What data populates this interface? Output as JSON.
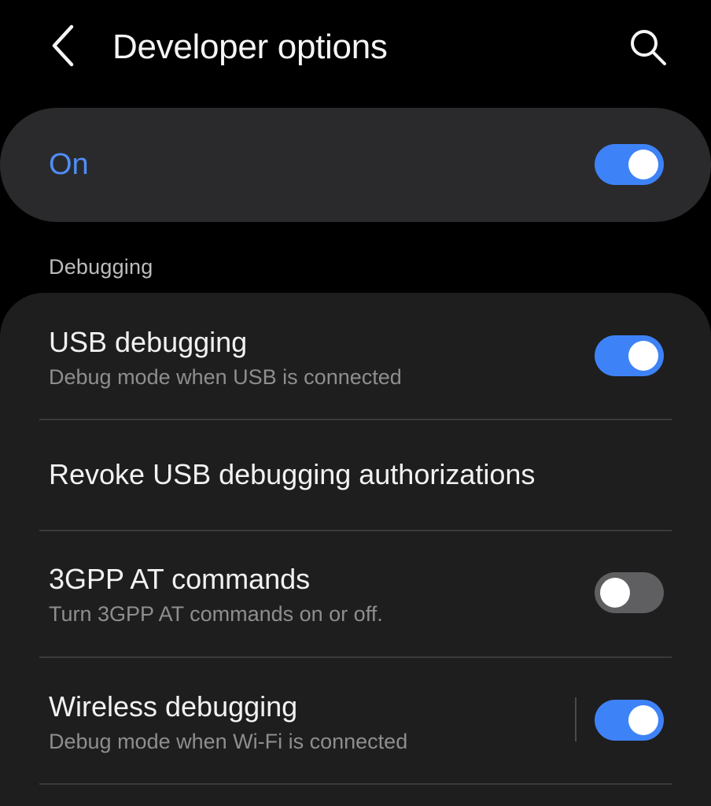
{
  "header": {
    "title": "Developer options",
    "back_icon": "chevron-left-icon",
    "search_icon": "search-icon"
  },
  "master": {
    "label": "On",
    "enabled": true
  },
  "section": {
    "title": "Debugging"
  },
  "items": [
    {
      "title": "USB debugging",
      "subtitle": "Debug mode when USB is connected",
      "toggle": "on"
    },
    {
      "title": "Revoke USB debugging authorizations"
    },
    {
      "title": "3GPP AT commands",
      "subtitle": "Turn 3GPP AT commands on or off.",
      "toggle": "off"
    },
    {
      "title": "Wireless debugging",
      "subtitle": "Debug mode when Wi-Fi is connected",
      "toggle": "on"
    }
  ],
  "colors": {
    "background": "#000000",
    "card": "#2a2a2c",
    "list_card": "#1e1e1f",
    "accent": "#3e82f7",
    "accent_text": "#4f8ef7",
    "switch_off": "#5f5f61"
  }
}
